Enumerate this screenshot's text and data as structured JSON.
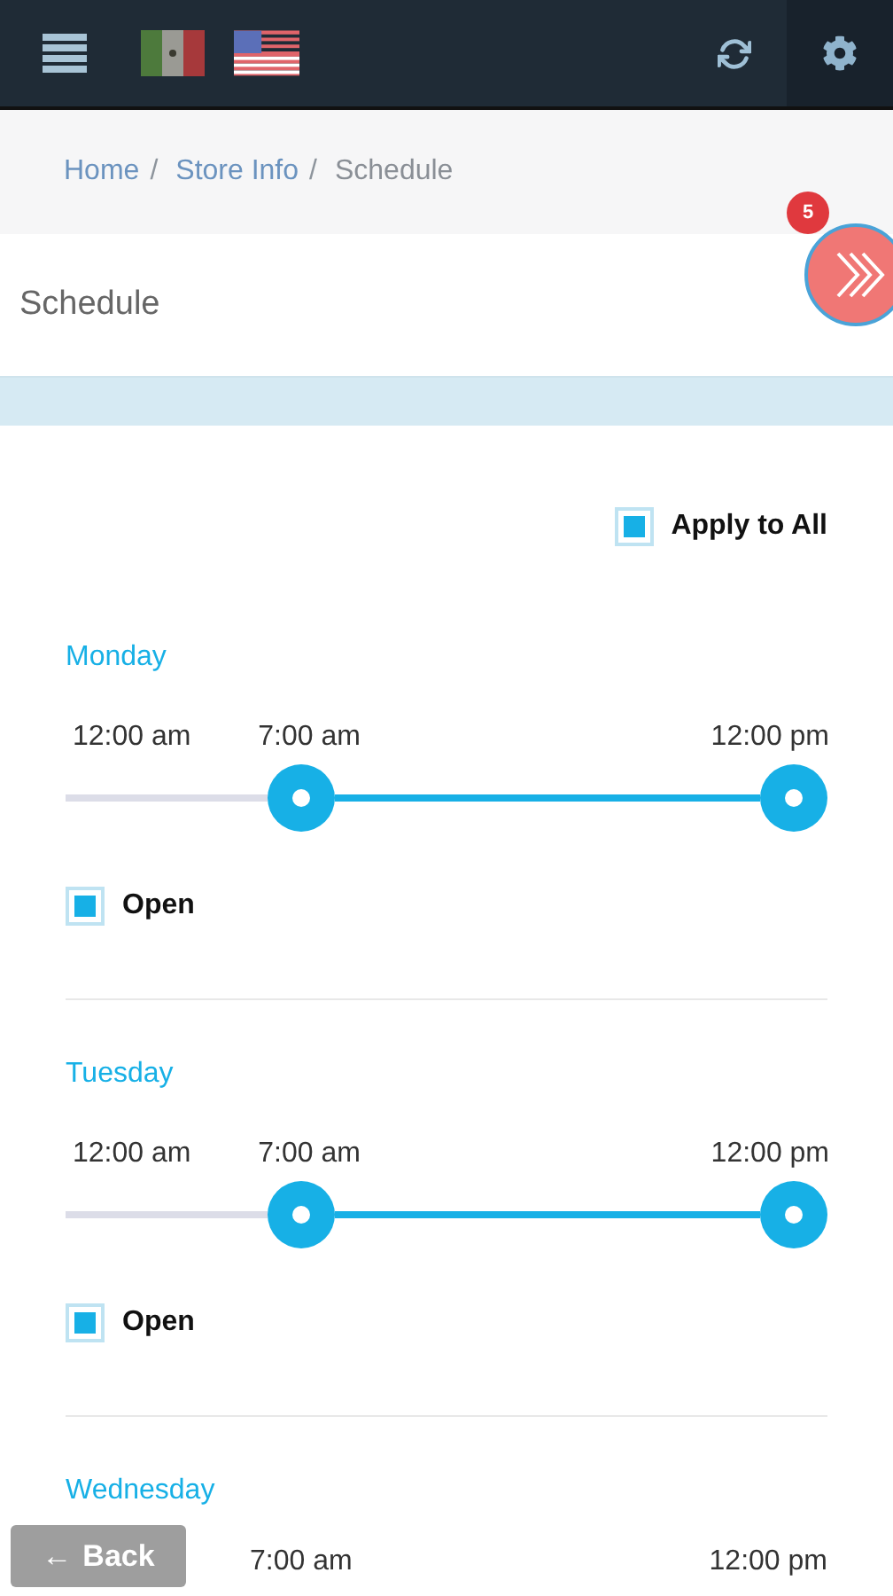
{
  "breadcrumb": [
    {
      "label": "Home",
      "selected": false
    },
    {
      "label": "Store Info",
      "selected": false
    },
    {
      "label": "Schedule",
      "selected": true
    }
  ],
  "breadcrumb_separator": "/",
  "notification_count": "5",
  "page_title": "Schedule",
  "apply_to_all": {
    "label": "Apply to All",
    "checked": true
  },
  "days": [
    {
      "name": "Monday",
      "min_label": "12:00 am",
      "handles": [
        {
          "label": "7:00 am",
          "level": 0.29
        },
        {
          "label": "12:00 pm",
          "level": 1
        }
      ],
      "open": {
        "label": "Open",
        "checked": true
      }
    },
    {
      "name": "Tuesday",
      "min_label": "12:00 am",
      "handles": [
        {
          "label": "7:00 am",
          "level": 0.29
        },
        {
          "label": "12:00 pm",
          "level": 1
        }
      ],
      "open": {
        "label": "Open",
        "checked": true
      }
    },
    {
      "name": "Wednesday",
      "handles": [
        {
          "label": "7:00 am"
        },
        {
          "label": "12:00 pm"
        }
      ]
    }
  ],
  "back_button": {
    "icon": "←",
    "label": "Back"
  }
}
